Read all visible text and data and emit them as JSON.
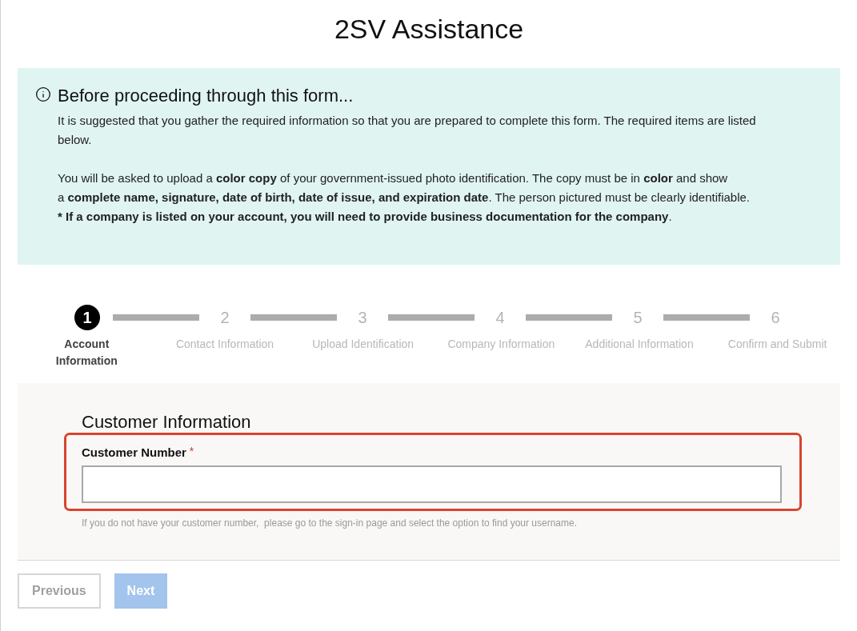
{
  "page_title": "2SV Assistance",
  "notice": {
    "title": "Before proceeding through this form...",
    "paragraphs": [
      [
        "It is suggested that you gather the required information so that you are prepared to complete this form. The required items are listed",
        "below."
      ],
      [
        "You will be asked to upload a **color copy** of your government-issued photo identification. The copy must be in **color** and show",
        "a **complete name, signature, date of birth, date of issue, and expiration date**. The person pictured must be clearly identifiable."
      ]
    ],
    "note": {
      "bold_text": "* If a company is listed on your account, you will need to provide business documentation for the company",
      "tail": "."
    }
  },
  "steps": [
    {
      "number": "1",
      "label": "Account Information",
      "selected": true
    },
    {
      "number": "2",
      "label": "Contact Information",
      "selected": false
    },
    {
      "number": "3",
      "label": "Upload Identification",
      "selected": false
    },
    {
      "number": "4",
      "label": "Company Information",
      "selected": false
    },
    {
      "number": "5",
      "label": "Additional Information",
      "selected": false
    },
    {
      "number": "6",
      "label": "Confirm and Submit",
      "selected": false
    }
  ],
  "form": {
    "heading": "Customer Information",
    "field": {
      "label": "Customer Number",
      "required_mark": "*",
      "highlighted": true,
      "hint": "If you do not have your customer number,  please go to the sign-in page and select the option to find your username."
    }
  },
  "buttons": [
    {
      "label": "Previous",
      "kind": "secondary",
      "disabled": true
    },
    {
      "label": "Next",
      "kind": "primary",
      "disabled": true
    }
  ]
}
